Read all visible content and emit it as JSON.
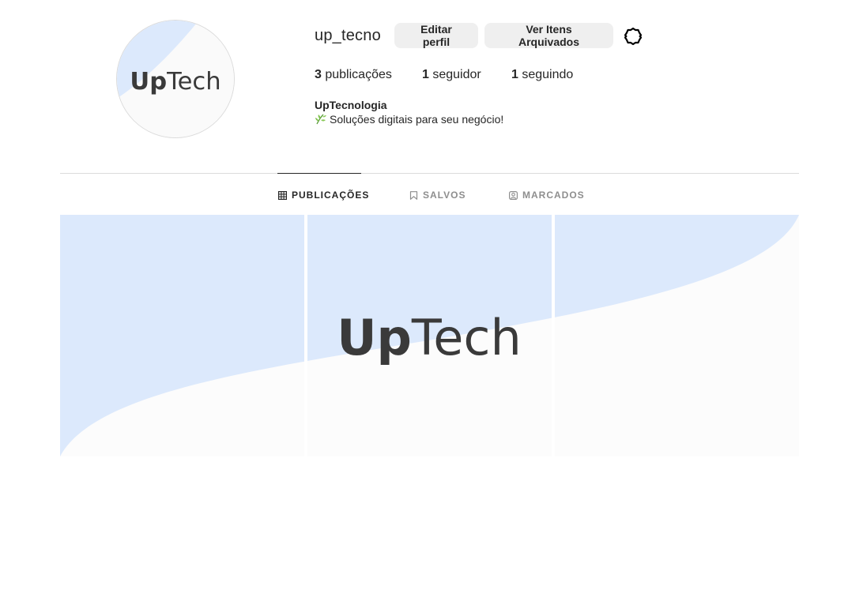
{
  "profile": {
    "username": "up_tecno",
    "avatar_logo": {
      "part_bold": "Up",
      "part_light": "Tech"
    },
    "edit_button": "Editar perfil",
    "archive_button": "Ver Itens Arquivados",
    "settings_icon": "gear-icon"
  },
  "stats": {
    "posts_count": "3",
    "posts_label": "publicações",
    "followers_count": "1",
    "followers_label": "seguidor",
    "following_count": "1",
    "following_label": "seguindo"
  },
  "bio": {
    "name": "UpTecnologia",
    "emoji_icon": "herb-icon",
    "text": "Soluções digitais para seu negócio!"
  },
  "tabs": [
    {
      "label": "PUBLICAÇÕES",
      "icon": "grid-icon",
      "active": true
    },
    {
      "label": "SALVOS",
      "icon": "bookmark-icon",
      "active": false
    },
    {
      "label": "MARCADOS",
      "icon": "tag-user-icon",
      "active": false
    }
  ],
  "posts": {
    "count": 3,
    "banner_logo": {
      "part_bold": "Up",
      "part_light": "Tech"
    }
  },
  "colors": {
    "accent_blue": "#dce9fc",
    "background": "#ffffff",
    "button_bg": "#efefef",
    "text": "#262626",
    "muted": "#8e8e8e",
    "border": "#dbdbdb"
  }
}
